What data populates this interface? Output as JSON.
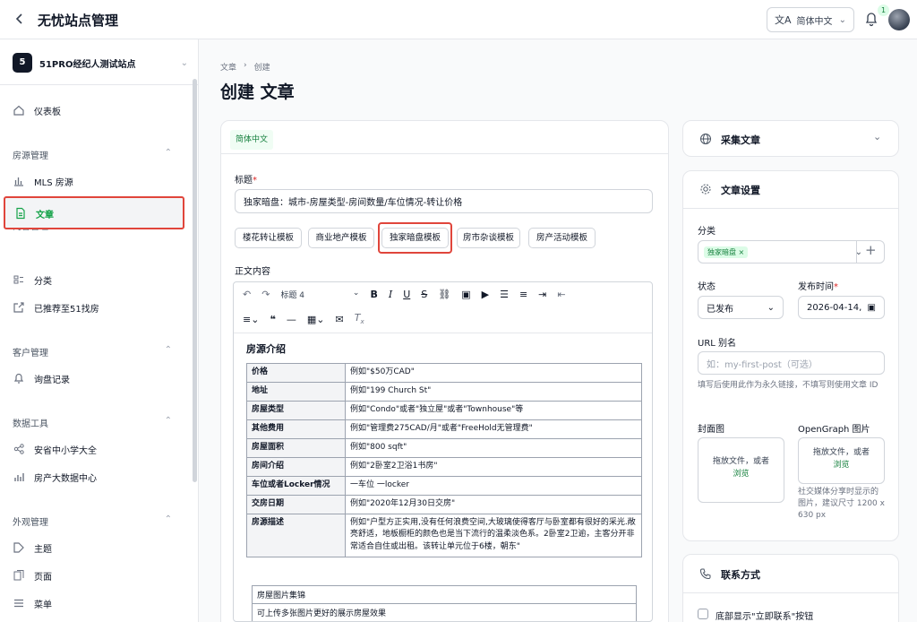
{
  "topbar": {
    "title": "无忧站点管理",
    "language": "简体中文",
    "notifications": "1"
  },
  "sidebar": {
    "site": {
      "number": "5",
      "name": "51PRO经纪人测试站点"
    },
    "dashboard": "仪表板",
    "groups": [
      {
        "label": "房源管理",
        "items": [
          "MLS 房源"
        ]
      },
      {
        "label": "内容管理",
        "items": [
          "文章",
          "分类",
          "已推荐至51找房"
        ]
      },
      {
        "label": "客户管理",
        "items": [
          "询盘记录"
        ]
      },
      {
        "label": "数据工具",
        "items": [
          "安省中小学大全",
          "房产大数据中心"
        ]
      },
      {
        "label": "外观管理",
        "items": [
          "主题",
          "页面",
          "菜单"
        ]
      }
    ]
  },
  "breadcrumb": [
    "文章",
    "创建"
  ],
  "page_title": "创建 文章",
  "form": {
    "lang_tab": "简体中文",
    "title_label": "标题",
    "title_value": "独家暗盘：城市-房屋类型-房间数量/车位情况-转让价格",
    "templates": [
      "楼花转让模板",
      "商业地产模板",
      "独家暗盘模板",
      "房市杂谈模板",
      "房产活动模板"
    ],
    "body_label": "正文内容",
    "heading_select": "标题 4",
    "section_title": "房源介绍",
    "rows": [
      {
        "k": "价格",
        "v": "例如\"$50万CAD\""
      },
      {
        "k": "地址",
        "v": "例如\"199 Church St\""
      },
      {
        "k": "房屋类型",
        "v": "例如\"Condo\"或者\"独立屋\"或者\"Townhouse\"等"
      },
      {
        "k": "其他费用",
        "v": "例如\"管理费275CAD/月\"或者\"FreeHold无管理费\""
      },
      {
        "k": "房屋面积",
        "v": "例如\"800 sqft\""
      },
      {
        "k": "房间介绍",
        "v": "例如\"2卧室2卫浴1书房\""
      },
      {
        "k": "车位或者Locker情况",
        "v": "一车位 一locker"
      },
      {
        "k": "交房日期",
        "v": "例如\"2020年12月30日交房\""
      },
      {
        "k": "房源描述",
        "v": "例如\"户型方正实用,没有任何浪费空间,大玻璃使得客厅与卧室都有很好的采光.敞亮舒适，地板橱柜的颜色也是当下流行的温柔淡色系。2卧室2卫逾，主客分开非常适合自住或出租。该转让单元位于6楼，朝东\""
      }
    ],
    "gallery_title": "房屋图片集锦",
    "gallery_hint": "可上传多张图片更好的展示房屋效果"
  },
  "right": {
    "collect": "采集文章",
    "settings": "文章设置",
    "category_label": "分类",
    "category_tag": "独家暗盘",
    "status_label": "状态",
    "status_value": "已发布",
    "date_label": "发布时间",
    "date_value": "2026-04-14,",
    "slug_label": "URL 别名",
    "slug_placeholder": "如：my-first-post（可选）",
    "slug_hint": "填写后使用此作为永久链接，不填写则使用文章 ID",
    "cover_label": "封面图",
    "og_label": "OpenGraph 图片",
    "drop_text": "拖放文件，或者",
    "drop_link": "浏览",
    "og_hint": "社交媒体分享时显示的图片，建议尺寸 1200 x 630 px",
    "contact": "联系方式",
    "contact_check": "底部显示\"立即联系\"按钮"
  }
}
